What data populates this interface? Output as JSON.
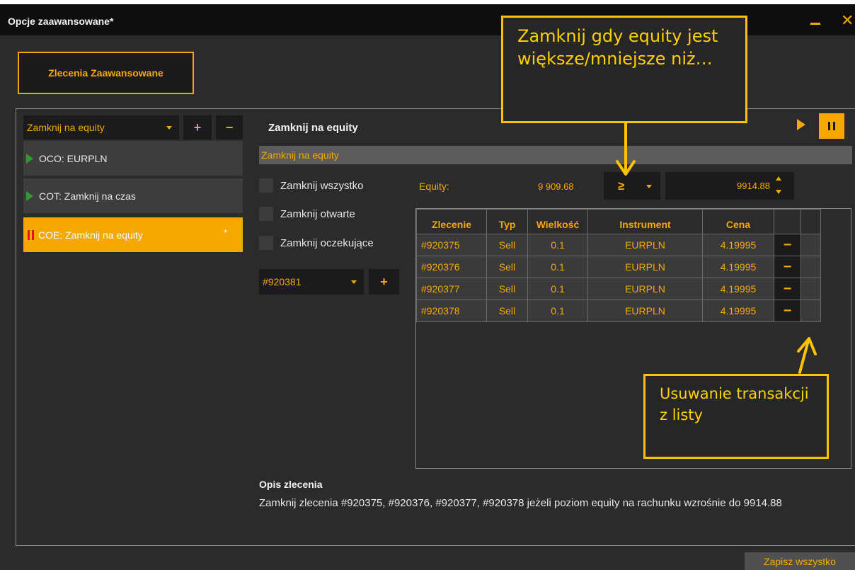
{
  "window": {
    "title": "Opcje zaawansowane*"
  },
  "main_tab": {
    "label": "Zlecenia Zaawansowane"
  },
  "left_panel": {
    "type_dropdown": "Zamknij na equity",
    "items": [
      {
        "label": "OCO: EURPLN",
        "state": "running"
      },
      {
        "label": "COT: Zamknij na czas",
        "state": "running"
      },
      {
        "label": "COE: Zamknij na equity",
        "state": "paused",
        "modified_marker": "*"
      }
    ]
  },
  "detail": {
    "title": "Zamknij na equity",
    "name_value": "Zamknij na equity",
    "checkboxes": [
      "Zamknij wszystko",
      "Zamknij otwarte",
      "Zamknij oczekujące"
    ],
    "order_dropdown": "#920381",
    "equity_label": "Equity:",
    "equity_value": "9 909.68",
    "operator": "≥",
    "target_value": "9914.88"
  },
  "orders_table": {
    "columns": [
      "Zlecenie",
      "Typ",
      "Wielkość",
      "Instrument",
      "Cena"
    ],
    "rows": [
      [
        "#920375",
        "Sell",
        "0.1",
        "EURPLN",
        "4.19995"
      ],
      [
        "#920376",
        "Sell",
        "0.1",
        "EURPLN",
        "4.19995"
      ],
      [
        "#920377",
        "Sell",
        "0.1",
        "EURPLN",
        "4.19995"
      ],
      [
        "#920378",
        "Sell",
        "0.1",
        "EURPLN",
        "4.19995"
      ]
    ],
    "remove_symbol": "−"
  },
  "description": {
    "title": "Opis zlecenia",
    "text": "Zamknij zlecenia #920375, #920376, #920377, #920378  jeżeli poziom equity na rachunku wzrośnie do 9914.88"
  },
  "footer": {
    "save_label": "Zapisz wszystko"
  },
  "callouts": {
    "operator_hint": "Zamknij gdy equity jest większe/mniejsze niż…",
    "remove_hint": "Usuwanie transakcji z listy"
  },
  "colors": {
    "accent": "#f5a800",
    "background": "#2b2b2b",
    "callout_border": "#ffc200",
    "running": "#2f9b2f",
    "paused": "#e0161b"
  }
}
